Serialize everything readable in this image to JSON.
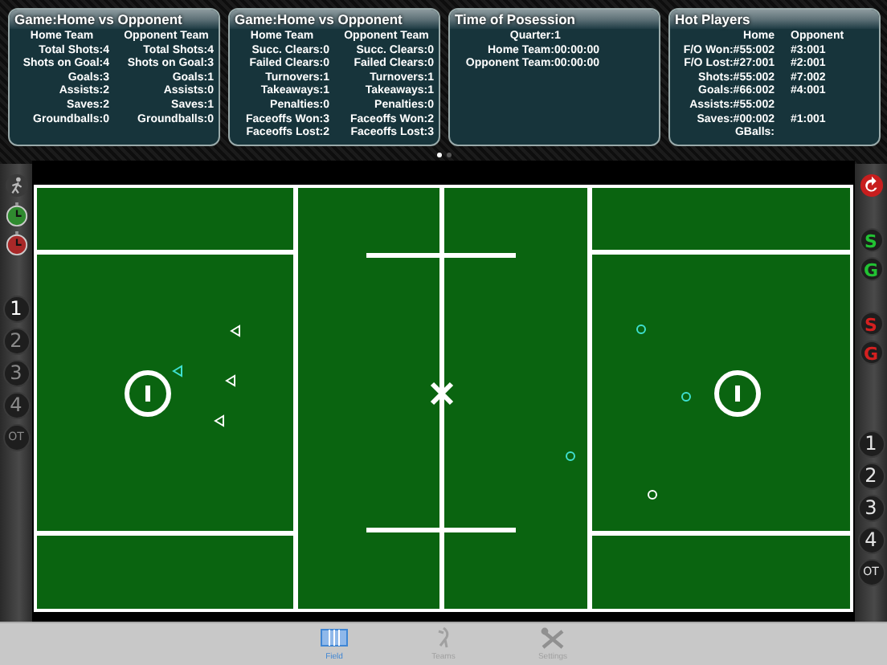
{
  "panels": [
    {
      "kind": "teams",
      "title": "Game:Home vs Opponent",
      "headers": [
        "Home Team",
        "Opponent Team"
      ],
      "rows": [
        [
          "Total Shots:4",
          "Total Shots:4"
        ],
        [
          "Shots on Goal:4",
          "Shots on Goal:3"
        ],
        [
          "Goals:3",
          "Goals:1"
        ],
        [
          "Assists:2",
          "Assists:0"
        ],
        [
          "Saves:2",
          "Saves:1"
        ],
        [
          "Groundballs:0",
          "Groundballs:0"
        ]
      ]
    },
    {
      "kind": "teams",
      "title": "Game:Home vs Opponent",
      "headers": [
        "Home Team",
        "Opponent Team"
      ],
      "rows": [
        [
          "Succ. Clears:0",
          "Succ. Clears:0"
        ],
        [
          "Failed Clears:0",
          "Failed Clears:0"
        ],
        [
          "Turnovers:1",
          "Turnovers:1"
        ],
        [
          "Takeaways:1",
          "Takeaways:1"
        ],
        [
          "Penalties:0",
          "Penalties:0"
        ],
        [
          "Faceoffs Won:3",
          "Faceoffs Won:2"
        ],
        [
          "Faceoffs Lost:2",
          "Faceoffs Lost:3"
        ]
      ]
    },
    {
      "kind": "possession",
      "title": "Time of Posession",
      "lines": [
        {
          "label": "Quarter:",
          "value": "1"
        },
        {
          "label": "Home Team:",
          "value": "00:00:00"
        },
        {
          "label": "Opponent Team:",
          "value": "00:00:00"
        }
      ]
    },
    {
      "kind": "hot",
      "title": "Hot Players",
      "headers": [
        "Home",
        "Opponent"
      ],
      "rows": [
        [
          "F/O Won:#55:002",
          "#3:001"
        ],
        [
          "F/O Lost:#27:001",
          "#2:001"
        ],
        [
          "Shots:#55:002",
          "#7:002"
        ],
        [
          "Goals:#66:002",
          "#4:001"
        ],
        [
          "Assists:#55:002"
        ],
        [
          "Saves:#00:002",
          "#1:001"
        ],
        [
          "GBalls:"
        ]
      ]
    }
  ],
  "page_dots": [
    {
      "selected": true
    },
    {
      "selected": false
    }
  ],
  "left_toolbar": {
    "periods": [
      {
        "label": "1",
        "selected": true
      },
      {
        "label": "2",
        "selected": false
      },
      {
        "label": "3",
        "selected": false
      },
      {
        "label": "4",
        "selected": false
      },
      {
        "label": "OT",
        "selected": false
      }
    ]
  },
  "right_toolbar": {
    "markers": [
      {
        "label": "S",
        "color": "#22c233"
      },
      {
        "label": "G",
        "color": "#22c233"
      },
      {
        "label": "S",
        "color": "#d42020"
      },
      {
        "label": "G",
        "color": "#d42020"
      }
    ],
    "periods": [
      {
        "label": "1"
      },
      {
        "label": "2"
      },
      {
        "label": "3"
      },
      {
        "label": "4"
      },
      {
        "label": "OT"
      }
    ]
  },
  "tabs": [
    {
      "kind": "field",
      "label": "Field",
      "selected": true
    },
    {
      "kind": "teams",
      "label": "Teams",
      "selected": false
    },
    {
      "kind": "settings",
      "label": "Settings",
      "selected": false
    }
  ]
}
